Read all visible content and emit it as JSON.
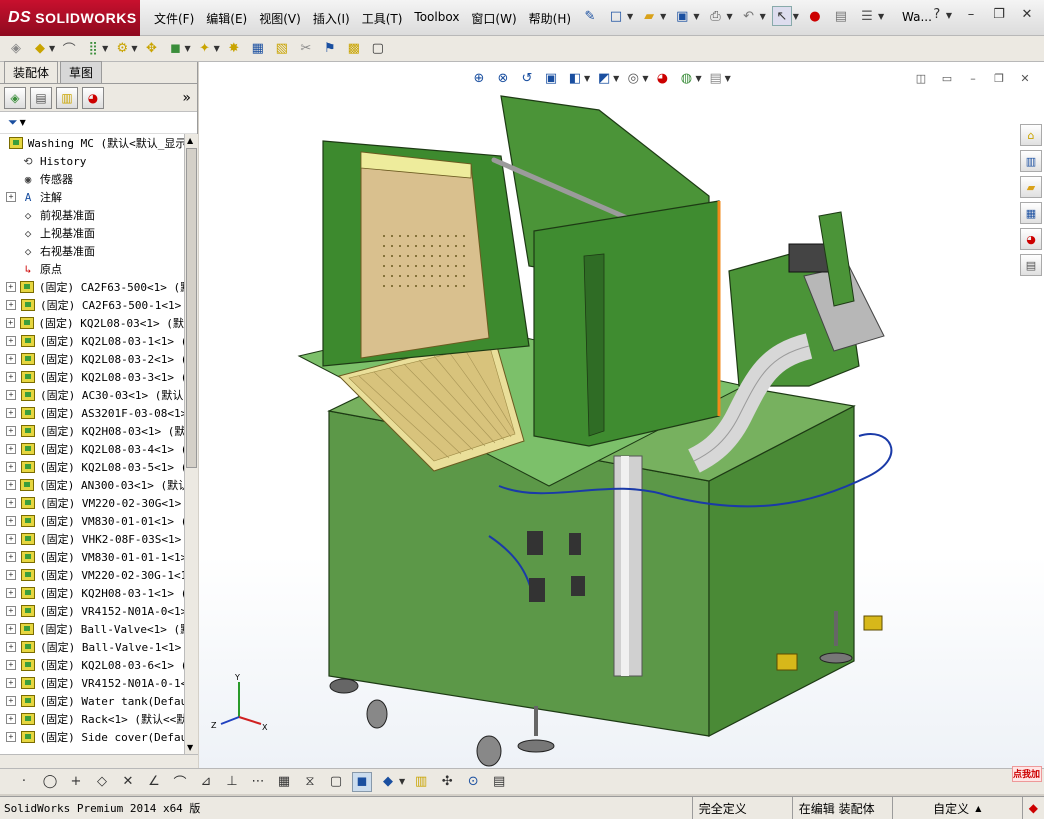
{
  "app": {
    "logo": "SOLIDWORKS",
    "logo_prefix": "DS",
    "doc_title": "Wa...",
    "menus": [
      "文件(F)",
      "编辑(E)",
      "视图(V)",
      "插入(I)",
      "工具(T)",
      "Toolbox",
      "窗口(W)",
      "帮助(H)"
    ]
  },
  "panel": {
    "tabs": [
      "装配体",
      "草图"
    ],
    "active_tab": "草图",
    "more": "»"
  },
  "tree": [
    {
      "label": "Washing MC  (默认<默认_显示",
      "icon": "asm",
      "exp": false,
      "root": true
    },
    {
      "label": "History",
      "icon": "history-icon",
      "exp": false
    },
    {
      "label": "传感器",
      "icon": "sensor-icon",
      "exp": false
    },
    {
      "label": "注解",
      "icon": "annotation-icon",
      "exp": true
    },
    {
      "label": "前视基准面",
      "icon": "plane-icon",
      "exp": false
    },
    {
      "label": "上视基准面",
      "icon": "plane-icon",
      "exp": false
    },
    {
      "label": "右视基准面",
      "icon": "plane-icon",
      "exp": false
    },
    {
      "label": "原点",
      "icon": "origin-icon",
      "exp": false
    },
    {
      "label": "(固定) CA2F63-500<1> (默",
      "icon": "asm",
      "exp": true
    },
    {
      "label": "(固定) CA2F63-500-1<1>",
      "icon": "asm",
      "exp": true
    },
    {
      "label": "(固定) KQ2L08-03<1> (默认",
      "icon": "asm",
      "exp": true
    },
    {
      "label": "(固定) KQ2L08-03-1<1> (",
      "icon": "asm",
      "exp": true
    },
    {
      "label": "(固定) KQ2L08-03-2<1> (",
      "icon": "asm",
      "exp": true
    },
    {
      "label": "(固定) KQ2L08-03-3<1> (",
      "icon": "asm",
      "exp": true
    },
    {
      "label": "(固定) AC30-03<1> (默认",
      "icon": "asm",
      "exp": true
    },
    {
      "label": "(固定) AS3201F-03-08<1>",
      "icon": "asm",
      "exp": true
    },
    {
      "label": "(固定) KQ2H08-03<1> (默",
      "icon": "asm",
      "exp": true
    },
    {
      "label": "(固定) KQ2L08-03-4<1> (",
      "icon": "asm",
      "exp": true
    },
    {
      "label": "(固定) KQ2L08-03-5<1> (",
      "icon": "asm",
      "exp": true
    },
    {
      "label": "(固定) AN300-03<1> (默认",
      "icon": "asm",
      "exp": true
    },
    {
      "label": "(固定) VM220-02-30G<1>",
      "icon": "asm",
      "exp": true
    },
    {
      "label": "(固定) VM830-01-01<1> (",
      "icon": "asm",
      "exp": true
    },
    {
      "label": "(固定) VHK2-08F-03S<1>",
      "icon": "asm",
      "exp": true
    },
    {
      "label": "(固定) VM830-01-01-1<1>",
      "icon": "asm",
      "exp": true
    },
    {
      "label": "(固定) VM220-02-30G-1<1",
      "icon": "asm",
      "exp": true
    },
    {
      "label": "(固定) KQ2H08-03-1<1> (",
      "icon": "asm",
      "exp": true
    },
    {
      "label": "(固定) VR4152-N01A-0<1>",
      "icon": "asm",
      "exp": true
    },
    {
      "label": "(固定) Ball-Valve<1> (默",
      "icon": "asm",
      "exp": true
    },
    {
      "label": "(固定) Ball-Valve-1<1>",
      "icon": "asm",
      "exp": true
    },
    {
      "label": "(固定) KQ2L08-03-6<1> (",
      "icon": "asm",
      "exp": true
    },
    {
      "label": "(固定) VR4152-N01A-0-1<",
      "icon": "asm",
      "exp": true
    },
    {
      "label": "(固定) Water tank(Defau",
      "icon": "asm",
      "exp": true
    },
    {
      "label": "(固定) Rack<1> (默认<<默",
      "icon": "asm",
      "exp": true
    },
    {
      "label": "(固定) Side cover(Defau",
      "icon": "asm",
      "exp": true
    }
  ],
  "axes": {
    "x": "X",
    "y": "Y",
    "z": "Z"
  },
  "status": {
    "product": "SolidWorks Premium 2014 x64 版",
    "state": "完全定义",
    "editing": "在编辑 装配体",
    "units": "自定义",
    "help_badge": "点我加"
  },
  "colors": {
    "machine_green": "#4f9a3a",
    "panel_tan": "#d9c08e",
    "brand_red": "#c8102e"
  }
}
